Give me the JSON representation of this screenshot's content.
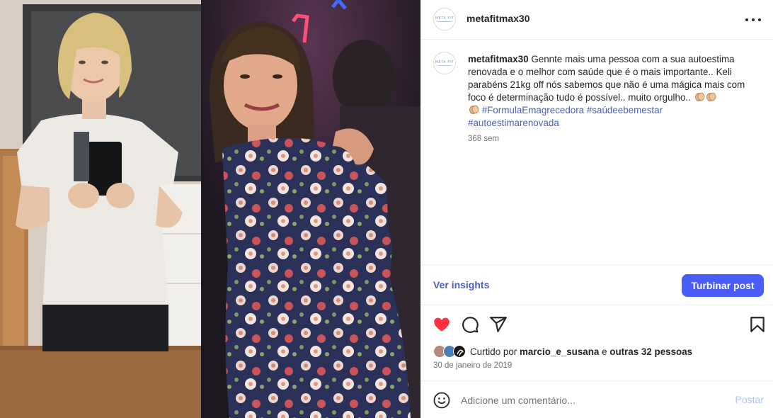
{
  "post": {
    "username": "metafitmax30",
    "avatar_logo_text": "META FIT",
    "caption_user": "metafitmax30",
    "caption_text": " Gennte mais uma pessoa com a sua autoestima renovada e o melhor com saúde que é o mais importante.. Keli parabéns 21kg off nós sabemos que não é uma mágica mais com foco é determinação tudo é possível.. muito orgulho.. ",
    "hashtags": [
      "#FormulaEmagrecedora",
      "#saúdeebemestar",
      "#autoestimarenovada"
    ],
    "time_ago": "368 sem",
    "emoji": "clapping-hands-icon"
  },
  "insights": {
    "link_label": "Ver insights",
    "boost_label": "Turbinar post"
  },
  "actions": {
    "liked": true,
    "like_color": "#ff3040"
  },
  "likes": {
    "prefix": "Curtido por ",
    "first_user": "marcio_e_susana",
    "middle": " e ",
    "others": "outras 32 pessoas"
  },
  "post_date": "30 de janeiro de 2019",
  "comment": {
    "placeholder": "Adicione um comentário...",
    "post_label": "Postar"
  },
  "colors": {
    "accent": "#4a5df9",
    "link": "#4a5fc1",
    "muted": "#737373"
  }
}
